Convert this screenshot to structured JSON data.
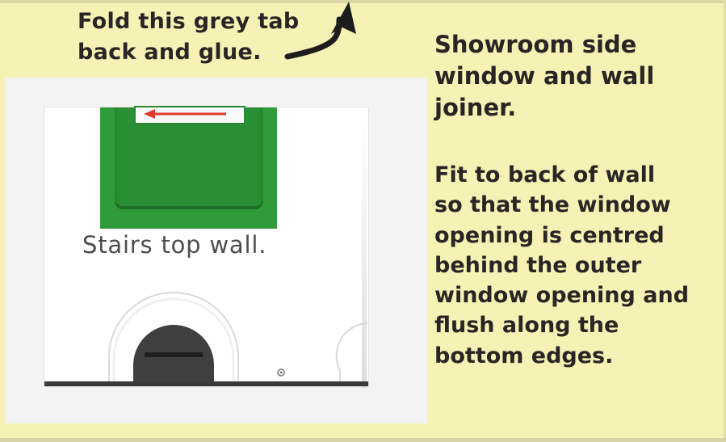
{
  "fold_note": {
    "line1": "Fold this grey tab",
    "line2": "back and glue."
  },
  "title": {
    "line1": "Showroom side",
    "line2": "window and wall",
    "line3": "joiner."
  },
  "instructions": {
    "line1": "Fit to back of wall",
    "line2": "so that the window",
    "line3": "opening is centred",
    "line4": "behind the outer",
    "line5": "window opening and",
    "line6": "flush along the",
    "line7": "bottom edges."
  },
  "piece": {
    "caption": "Stairs top wall."
  },
  "colors": {
    "background": "#f6f1b4",
    "green": "#2f9b3a",
    "red_arrow": "#e23b2a",
    "text": "#2a2524"
  },
  "icons": {
    "fold_arrow": "curved-arrow-up-icon",
    "direction_arrow": "arrow-left-icon"
  }
}
